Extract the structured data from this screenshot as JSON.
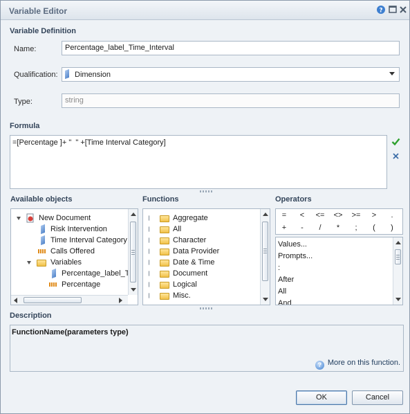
{
  "window": {
    "title": "Variable Editor"
  },
  "titlebar_icons": [
    "help-icon",
    "maximize-icon",
    "close-icon"
  ],
  "definition": {
    "heading": "Variable Definition",
    "name_label": "Name:",
    "name_value": "Percentage_label_Time_Interval",
    "qualification_label": "Qualification:",
    "qualification_value": "Dimension",
    "type_label": "Type:",
    "type_placeholder": "string"
  },
  "formula": {
    "heading": "Formula",
    "text": "=[Percentage ]+ \"  \" +[Time Interval Category]",
    "validate_icon": "check-icon",
    "clear_icon": "clear-icon"
  },
  "available_objects": {
    "heading": "Available objects",
    "items": [
      {
        "label": "New Document",
        "icon": "document-icon",
        "level": 0
      },
      {
        "label": "Risk Intervention",
        "icon": "dimension-icon",
        "level": 1
      },
      {
        "label": "Time Interval Category",
        "icon": "dimension-icon",
        "level": 1
      },
      {
        "label": "Calls Offered",
        "icon": "measure-icon",
        "level": 1
      },
      {
        "label": "Variables",
        "icon": "folder-icon",
        "level": 1
      },
      {
        "label": "Percentage_label_T",
        "icon": "dimension-icon",
        "level": 2
      },
      {
        "label": "Percentage",
        "icon": "measure-icon",
        "level": 2
      }
    ]
  },
  "functions": {
    "heading": "Functions",
    "items": [
      "Aggregate",
      "All",
      "Character",
      "Data Provider",
      "Date & Time",
      "Document",
      "Logical",
      "Misc."
    ]
  },
  "operators": {
    "heading": "Operators",
    "row1": [
      "=",
      "<",
      "<=",
      "<>",
      ">=",
      ">",
      "."
    ],
    "row2": [
      "+",
      "-",
      "/",
      "*",
      ";",
      "(",
      ")"
    ],
    "list": [
      "Values...",
      "Prompts...",
      ":",
      "After",
      "All",
      "And"
    ]
  },
  "description": {
    "heading": "Description",
    "signature": "FunctionName(parameters type)",
    "more_link": "More on this function."
  },
  "buttons": {
    "ok": "OK",
    "cancel": "Cancel"
  },
  "colors": {
    "accent": "#34455a",
    "check": "#2ea02e",
    "clear": "#3d6ea8"
  }
}
